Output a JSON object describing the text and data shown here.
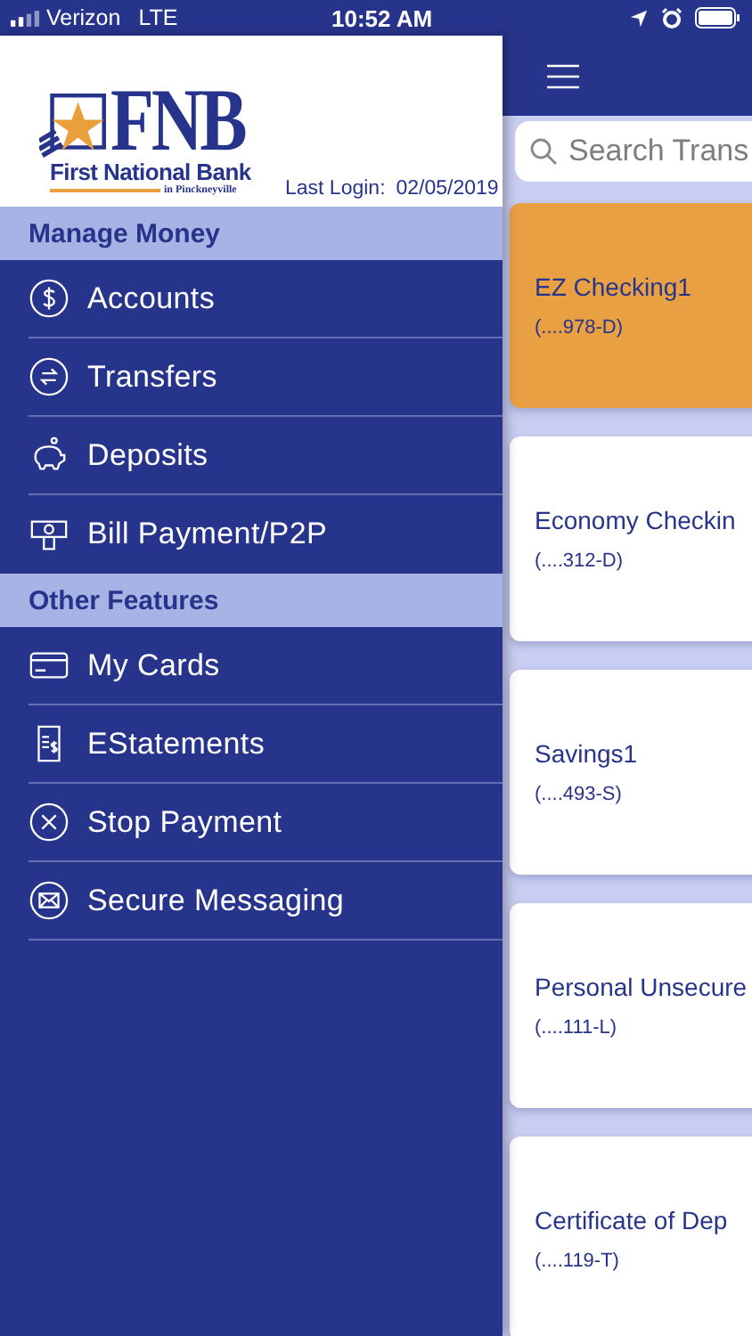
{
  "status_bar": {
    "carrier": "Verizon",
    "network": "LTE",
    "time": "10:52 AM"
  },
  "drawer": {
    "logo": {
      "initials": "FNB",
      "name": "First National Bank",
      "place": "in Pinckneyville"
    },
    "last_login": {
      "label": "Last Login:",
      "value": "02/05/2019"
    },
    "sections": [
      {
        "title": "Manage Money",
        "items": [
          {
            "label": "Accounts",
            "kind": "dollar"
          },
          {
            "label": "Transfers",
            "kind": "transfer"
          },
          {
            "label": "Deposits",
            "kind": "piggy"
          },
          {
            "label": "Bill Payment/P2P",
            "kind": "bill"
          }
        ]
      },
      {
        "title": "Other Features",
        "items": [
          {
            "label": "My Cards",
            "kind": "card"
          },
          {
            "label": "EStatements",
            "kind": "statement"
          },
          {
            "label": "Stop Payment",
            "kind": "stop"
          },
          {
            "label": "Secure Messaging",
            "kind": "message"
          }
        ]
      }
    ]
  },
  "accounts_panel": {
    "search": {
      "placeholder": "Search Trans"
    },
    "accounts": [
      {
        "name": "EZ Checking1",
        "number": "(....978-D)",
        "selected": true
      },
      {
        "name": "Economy Checkin",
        "number": "(....312-D)",
        "selected": false
      },
      {
        "name": "Savings1",
        "number": "(....493-S)",
        "selected": false
      },
      {
        "name": "Personal Unsecure",
        "number": "(....111-L)",
        "selected": false
      },
      {
        "name": "Certificate of Dep",
        "number": "(....119-T)",
        "selected": false
      }
    ]
  }
}
